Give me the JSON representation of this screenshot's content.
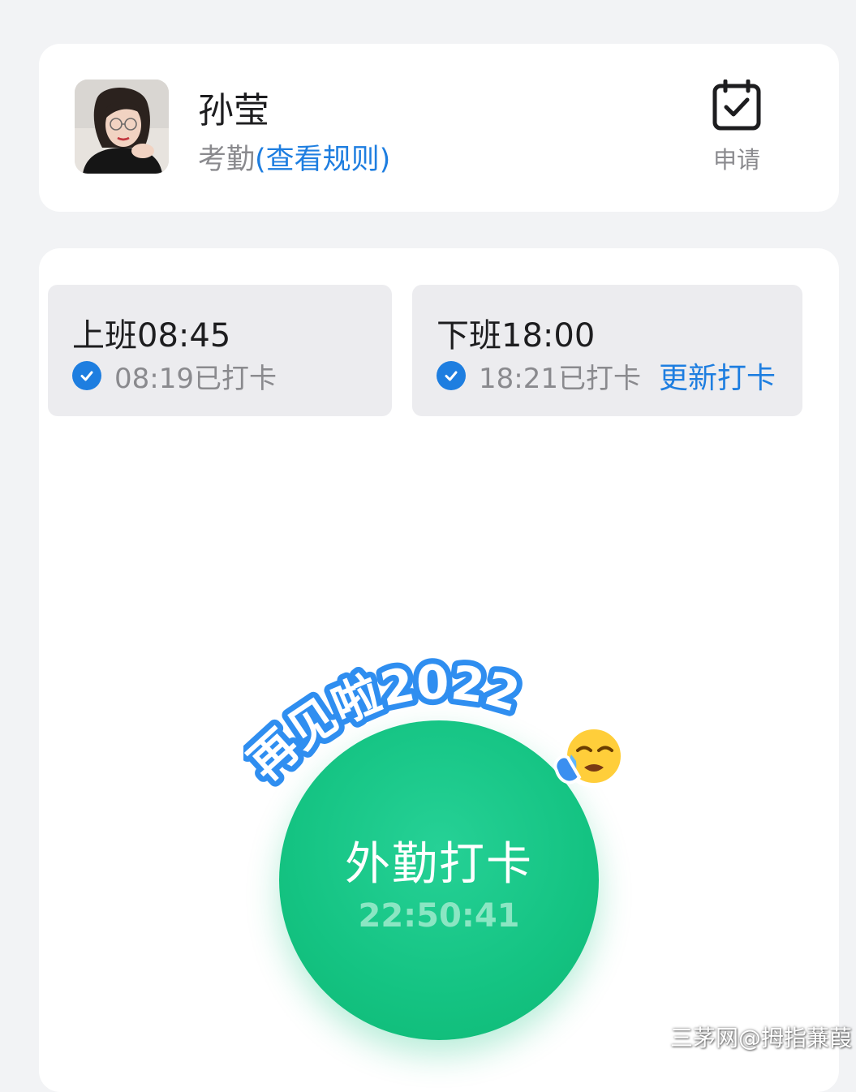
{
  "profile": {
    "name": "孙莹",
    "attendance_label": "考勤",
    "rules_link": "(查看规则)",
    "apply_label": "申请",
    "apply_icon": "calendar-check-icon"
  },
  "shifts": {
    "on_duty": {
      "title": "上班08:45",
      "status": "08:19已打卡",
      "icon": "check-circle-icon"
    },
    "off_duty": {
      "title": "下班18:00",
      "status": "18:21已打卡",
      "update_link": "更新打卡",
      "icon": "check-circle-icon"
    }
  },
  "punch": {
    "label": "外勤打卡",
    "time": "22:50:41"
  },
  "sticker": {
    "text": "再见啦2022",
    "emoji": "crying-face-icon"
  },
  "watermark": "三茅网@拇指蒹葭",
  "colors": {
    "accent_blue": "#1e7ee0",
    "punch_green": "#14c382",
    "background": "#f2f3f5"
  }
}
